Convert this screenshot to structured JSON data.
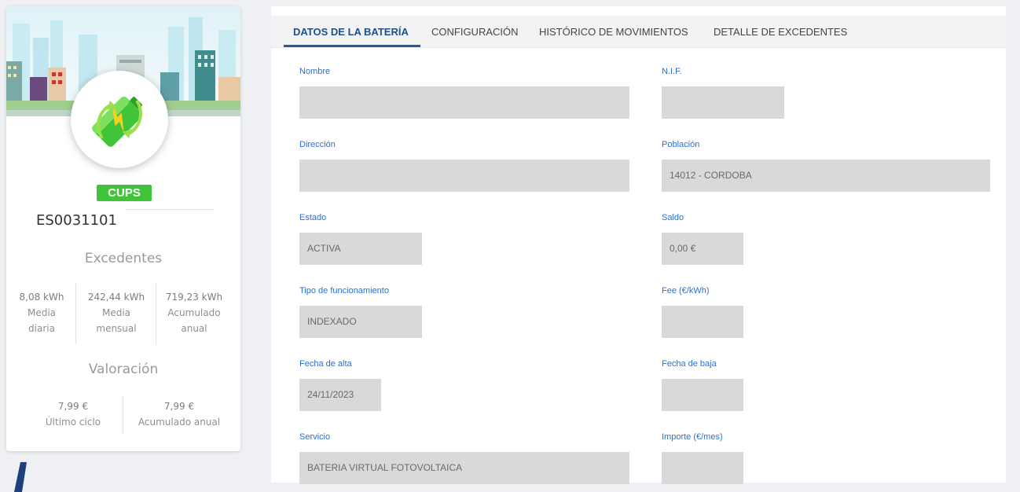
{
  "card": {
    "badge": "CUPS",
    "cups_code": "ES0031101",
    "excedentes": {
      "title": "Excedentes",
      "stats": [
        {
          "value": "8,08 kWh",
          "line1": "Media",
          "line2": "diaria"
        },
        {
          "value": "242,44 kWh",
          "line1": "Media",
          "line2": "mensual"
        },
        {
          "value": "719,23 kWh",
          "line1": "Acumulado",
          "line2": "anual"
        }
      ]
    },
    "valoracion": {
      "title": "Valoración",
      "stats": [
        {
          "value": "7,99 €",
          "label": "Último ciclo"
        },
        {
          "value": "7,99 €",
          "label": "Acumulado anual"
        }
      ]
    }
  },
  "tabs": [
    {
      "label": "DATOS DE LA BATERÍA",
      "active": true
    },
    {
      "label": "CONFIGURACIÓN",
      "active": false
    },
    {
      "label": "HISTÓRICO DE MOVIMIENTOS",
      "active": false
    },
    {
      "label": "DETALLE DE EXCEDENTES",
      "active": false
    }
  ],
  "form": {
    "nombre": {
      "label": "Nombre",
      "value": ""
    },
    "nif": {
      "label": "N.I.F.",
      "value": ""
    },
    "direccion": {
      "label": "Dirección",
      "value": ""
    },
    "poblacion": {
      "label": "Población",
      "value": "14012 - CORDOBA"
    },
    "estado": {
      "label": "Estado",
      "value": "ACTIVA"
    },
    "saldo": {
      "label": "Saldo",
      "value": "0,00 €"
    },
    "tipo": {
      "label": "Tipo de funcionamiento",
      "value": "INDEXADO"
    },
    "fee": {
      "label": "Fee (€/kWh)",
      "value": ""
    },
    "fecha_alta": {
      "label": "Fecha de alta",
      "value": "24/11/2023"
    },
    "fecha_baja": {
      "label": "Fecha de baja",
      "value": ""
    },
    "servicio": {
      "label": "Servicio",
      "value": "BATERIA VIRTUAL FOTOVOLTAICA"
    },
    "importe": {
      "label": "Importe (€/mes)",
      "value": ""
    }
  },
  "colors": {
    "accent": "#2a5a9b",
    "label_blue": "#2c6fd1",
    "badge_green": "#3fc43a",
    "field_bg": "#d9d9d9"
  },
  "icons": {
    "avatar": "battery-recycle-icon",
    "banner": "city-skyline-illustration"
  }
}
